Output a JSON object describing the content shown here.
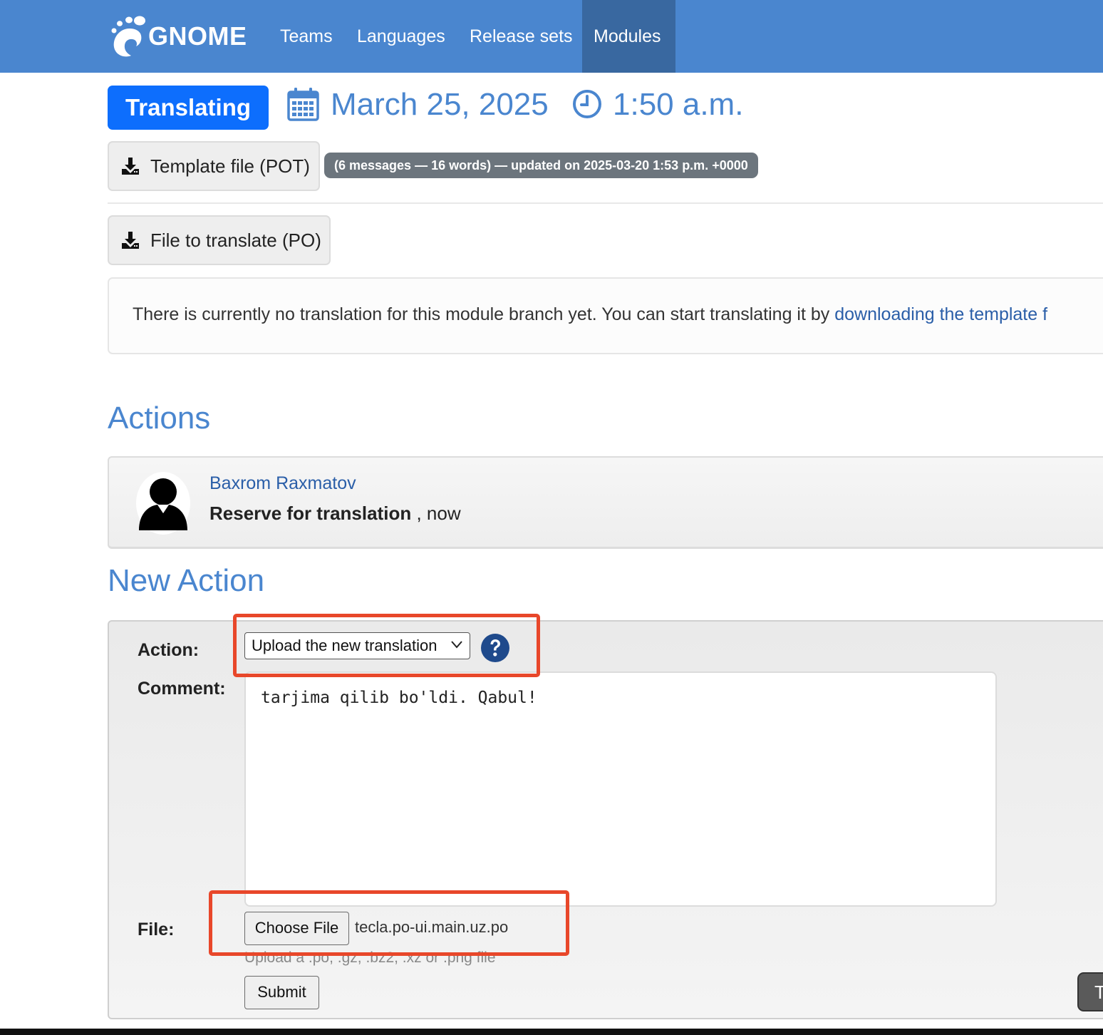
{
  "nav": {
    "brand": "GNOME",
    "items": [
      "Teams",
      "Languages",
      "Release sets",
      "Modules"
    ],
    "active": "Modules"
  },
  "status": {
    "badge": "Translating",
    "date": "March 25, 2025",
    "time": "1:50 a.m."
  },
  "downloads": {
    "pot_label": "Template file (POT)",
    "pot_stats": "(6 messages — 16 words) — updated on 2025-03-20 1:53 p.m. +0000",
    "po_label": "File to translate (PO)"
  },
  "info": {
    "text": "There is currently no translation for this module branch yet. You can start translating it by ",
    "link": "downloading the template f"
  },
  "actions_section": {
    "title": "Actions",
    "entries": [
      {
        "user": "Baxrom Raxmatov",
        "action": "Reserve for translation",
        "when": ", now"
      }
    ]
  },
  "new_action": {
    "title": "New Action",
    "action_label": "Action:",
    "action_selected": "Upload the new translation",
    "comment_label": "Comment:",
    "comment_value": "tarjima qilib bo'ldi. Qabul!",
    "file_label": "File:",
    "choose_file": "Choose File",
    "file_name": "tecla.po-ui.main.uz.po",
    "file_help": "Upload a .po, .gz, .bz2, .xz or .png file",
    "submit": "Submit",
    "corner_button": "T"
  },
  "colors": {
    "navbar": "#4a86cf",
    "nav_active": "#3968a0",
    "badge": "#0d6efd",
    "heading": "#4a86cf",
    "link": "#2a5ea8",
    "highlight": "#e8472a"
  },
  "icons": [
    "gnome-foot-icon",
    "calendar-icon",
    "clock-icon",
    "download-icon",
    "avatar-icon",
    "chevron-down-icon",
    "help-icon"
  ]
}
